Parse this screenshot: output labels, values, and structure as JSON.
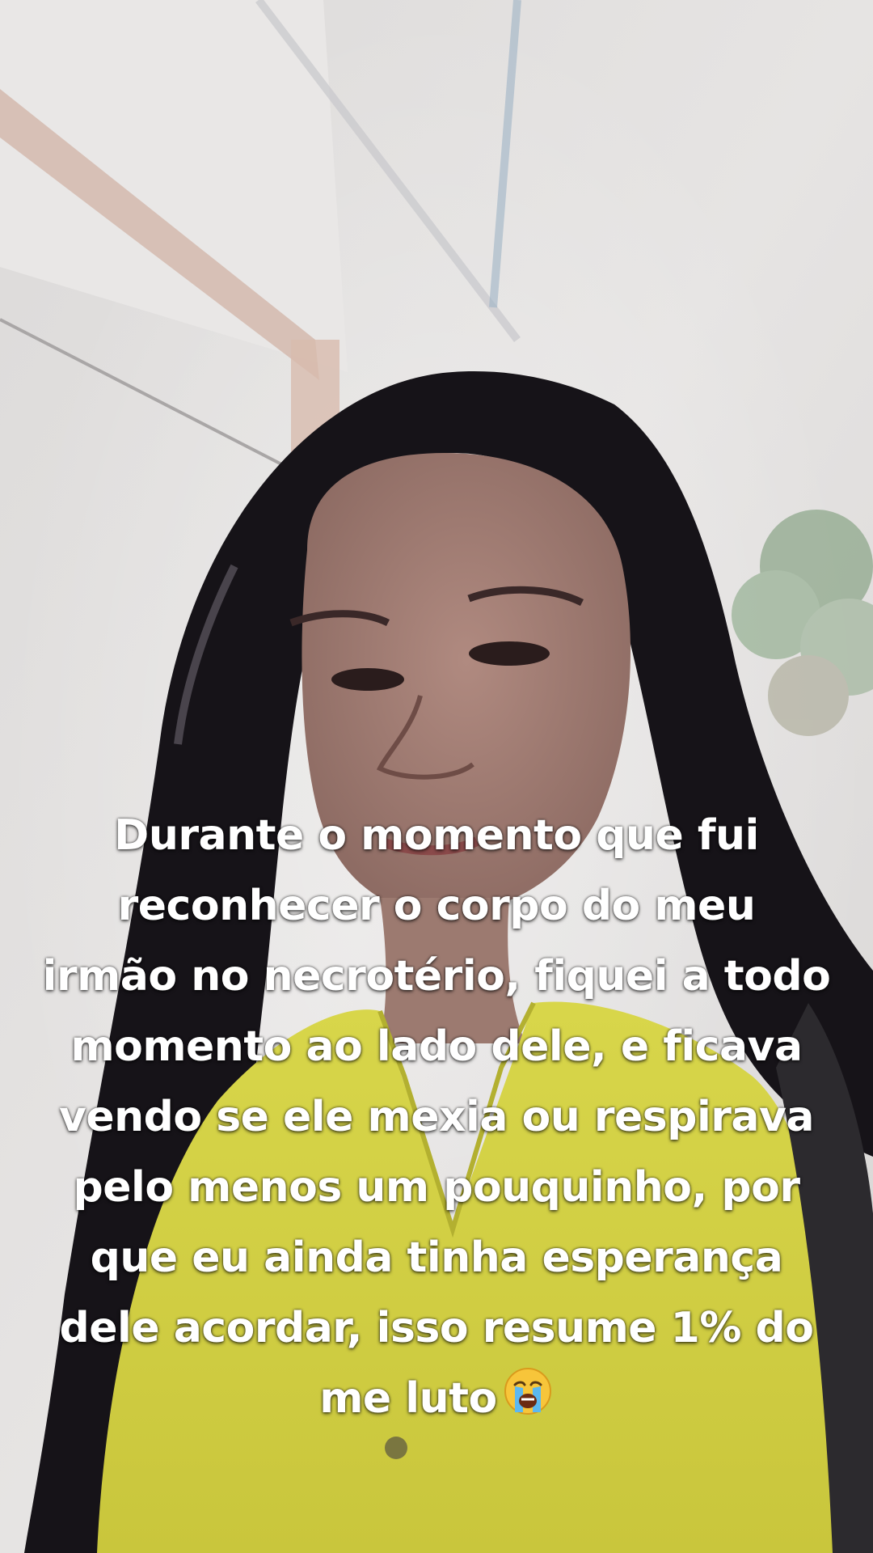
{
  "caption": {
    "lines": [
      "Durante o momento que fui",
      "reconhecer o corpo do meu",
      "irmão no necrotério, fiquei a todo",
      "momento ao lado dele, e ficava",
      "vendo se ele mexia ou respirava",
      "pelo menos um pouquinho, por",
      "que eu ainda tinha esperança",
      "dele acordar, isso resume 1% do",
      "me luto"
    ],
    "emoji": "loudly-crying-face-icon"
  },
  "colors": {
    "caption_text": "#ffffff",
    "shirt": "#d6d44a",
    "hair": "#161318",
    "wall": "#e4e2e1"
  }
}
